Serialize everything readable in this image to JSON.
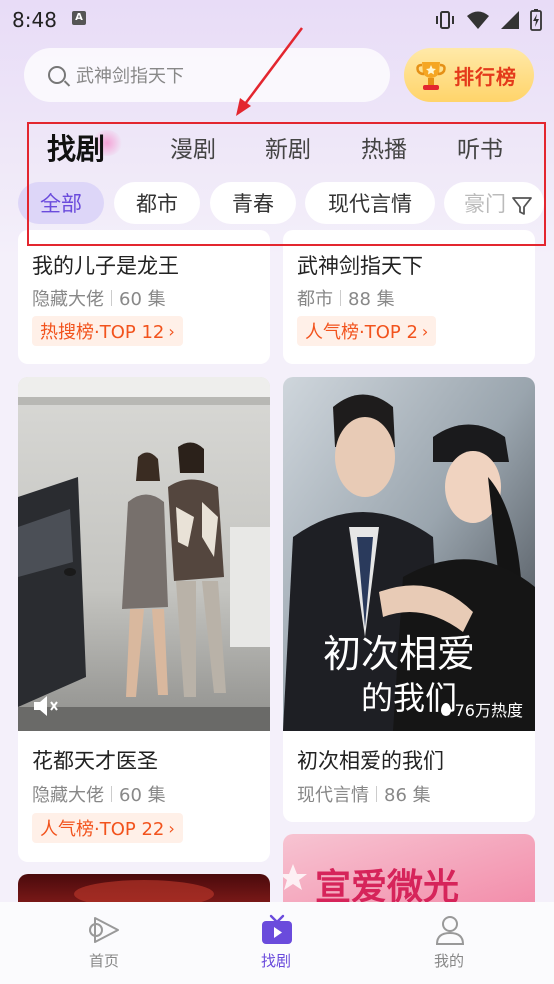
{
  "status_bar": {
    "time": "8:48",
    "notification_icon": "A"
  },
  "search": {
    "text": "武神剑指天下"
  },
  "rank_button": {
    "label": "排行榜"
  },
  "tabs": [
    {
      "label": "找剧",
      "active": true
    },
    {
      "label": "漫剧"
    },
    {
      "label": "新剧"
    },
    {
      "label": "热播"
    },
    {
      "label": "听书"
    }
  ],
  "chips": [
    {
      "label": "全部",
      "active": true
    },
    {
      "label": "都市"
    },
    {
      "label": "青春"
    },
    {
      "label": "现代言情"
    },
    {
      "label": "豪门"
    }
  ],
  "cards": [
    {
      "title": "我的儿子是龙王",
      "genre": "隐藏大佬",
      "episodes": "60 集",
      "badge": "热搜榜·TOP 12"
    },
    {
      "title": "武神剑指天下",
      "genre": "都市",
      "episodes": "88 集",
      "badge": "人气榜·TOP 2"
    },
    {
      "title": "花都天才医圣",
      "genre": "隐藏大佬",
      "episodes": "60 集",
      "badge": "人气榜·TOP 22"
    },
    {
      "title": "初次相爱的我们",
      "genre": "现代言情",
      "episodes": "86 集",
      "heat": "76万热度",
      "poster_title_1": "初次相爱",
      "poster_title_2": "的我们"
    },
    {
      "poster_title": "宣爱微光"
    }
  ],
  "bottom_nav": [
    {
      "label": "首页",
      "icon": "play-icon"
    },
    {
      "label": "找剧",
      "icon": "tv-icon",
      "active": true
    },
    {
      "label": "我的",
      "icon": "user-icon"
    }
  ],
  "colors": {
    "accent": "#6a4bdc",
    "annotation": "#e3262f",
    "badge_text": "#f2531d"
  }
}
